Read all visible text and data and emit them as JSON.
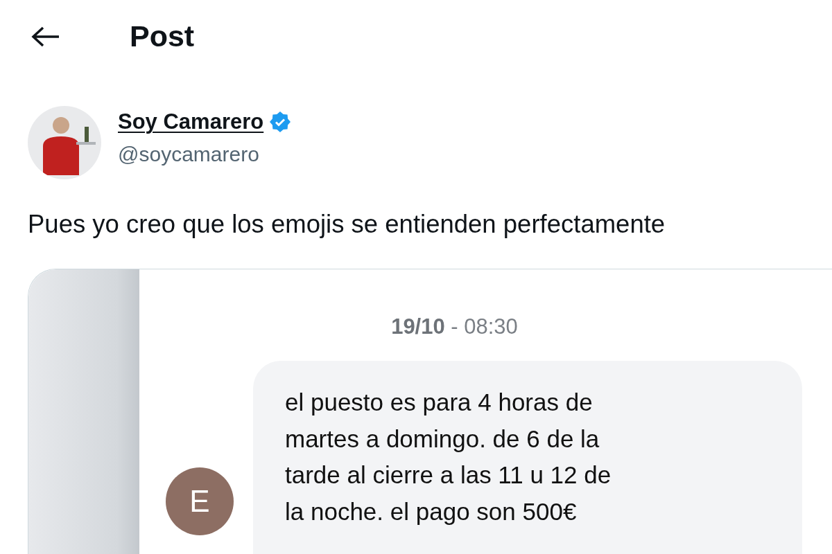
{
  "header": {
    "title": "Post"
  },
  "author": {
    "name": "Soy Camarero",
    "verified": true,
    "handle": "@soycamarero"
  },
  "text": "Pues yo creo que los emojis se entienden perfectamente",
  "attachment": {
    "timestamp": "**19/10** - 08:30",
    "sender_initial": "E",
    "message_lines": [
      "el puesto es para 4 horas de",
      "martes a domingo. de 6 de la",
      "tarde al cierre a las 11 u 12 de",
      "la noche. el pago son 500€"
    ]
  }
}
